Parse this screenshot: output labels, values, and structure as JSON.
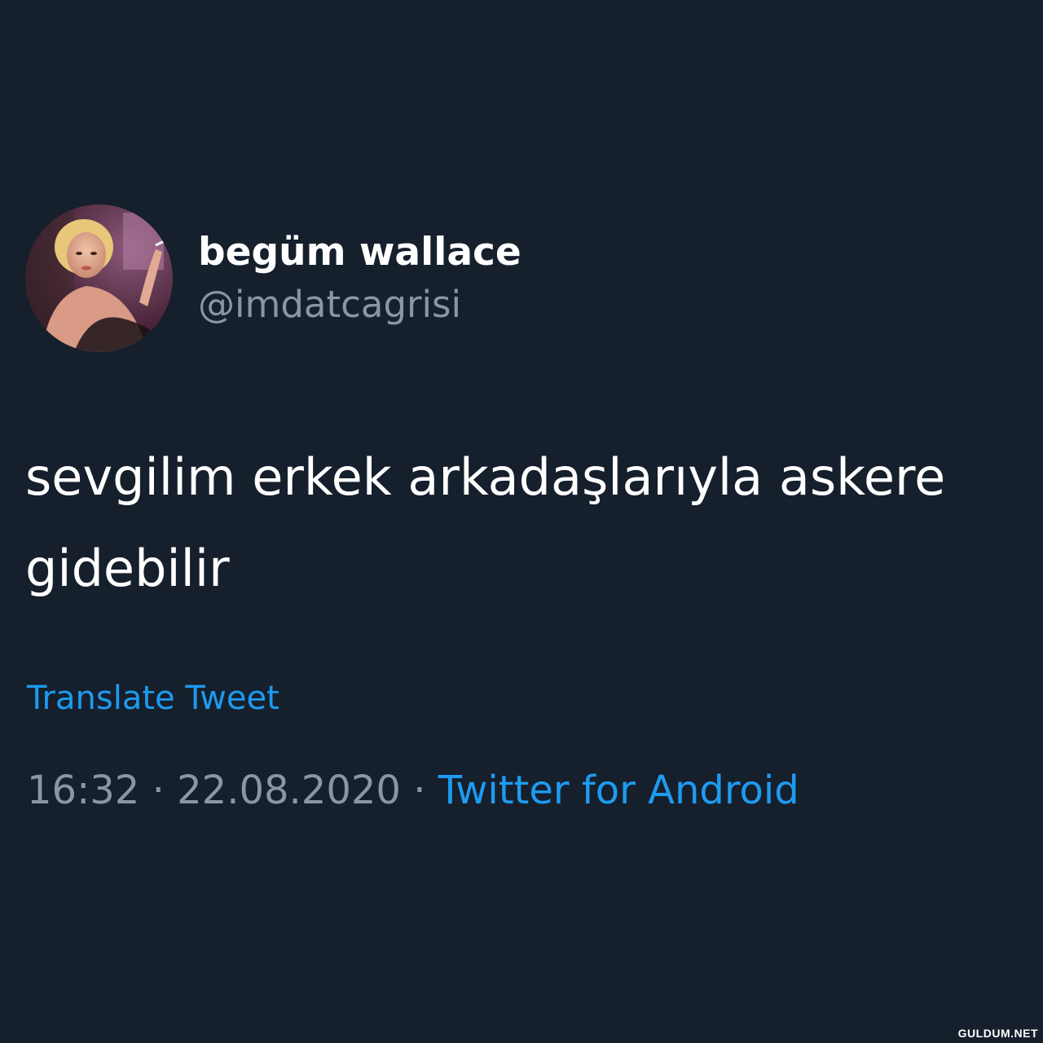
{
  "user": {
    "display_name": "begüm wallace",
    "handle": "@imdatcagrisi",
    "avatar_icon": "profile-photo"
  },
  "tweet": {
    "text": "sevgilim erkek arkadaşlarıyla askere gidebilir",
    "translate_label": "Translate Tweet",
    "time": "16:32",
    "separator": "·",
    "date": "22.08.2020",
    "source": "Twitter for Android"
  },
  "watermark": "GULDUM.NET",
  "colors": {
    "background": "#161f2c",
    "text": "#ffffff",
    "secondary": "#8a96a3",
    "link": "#1d9bf0"
  }
}
